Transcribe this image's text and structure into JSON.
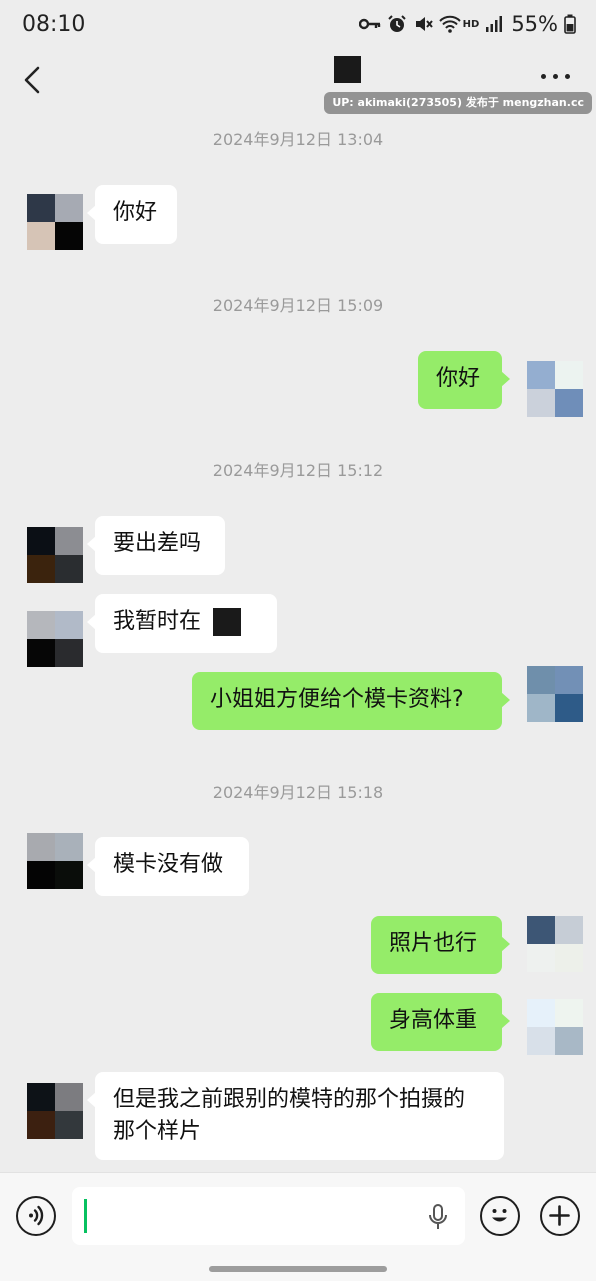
{
  "status_bar": {
    "time": "08:10",
    "network": "HD",
    "battery": "55%"
  },
  "watermark": "UP: akimaki(273505) 发布于 mengzhan.cc",
  "messages": {
    "ts1": "2024年9月12日 13:04",
    "m1": "你好",
    "ts2": "2024年9月12日 15:09",
    "m2": "你好",
    "ts3": "2024年9月12日 15:12",
    "m3": "要出差吗",
    "m4": "我暂时在",
    "m5": "小姐姐方便给个模卡资料?",
    "ts4": "2024年9月12日 15:18",
    "m6": "模卡没有做",
    "m7": "照片也行",
    "m8": "身高体重",
    "m9": "但是我之前跟别的模特的那个拍摄的那个样片"
  },
  "colors": {
    "sent_bubble": "#95ec69",
    "received_bubble": "#ffffff",
    "background": "#ededed",
    "caret": "#07c160"
  },
  "icons": [
    "back-arrow-icon",
    "more-icon",
    "voice-icon",
    "emoji-icon",
    "plus-icon",
    "mic-icon",
    "key-icon",
    "alarm-icon",
    "mute-icon",
    "wifi-icon",
    "signal-icon",
    "battery-icon"
  ]
}
